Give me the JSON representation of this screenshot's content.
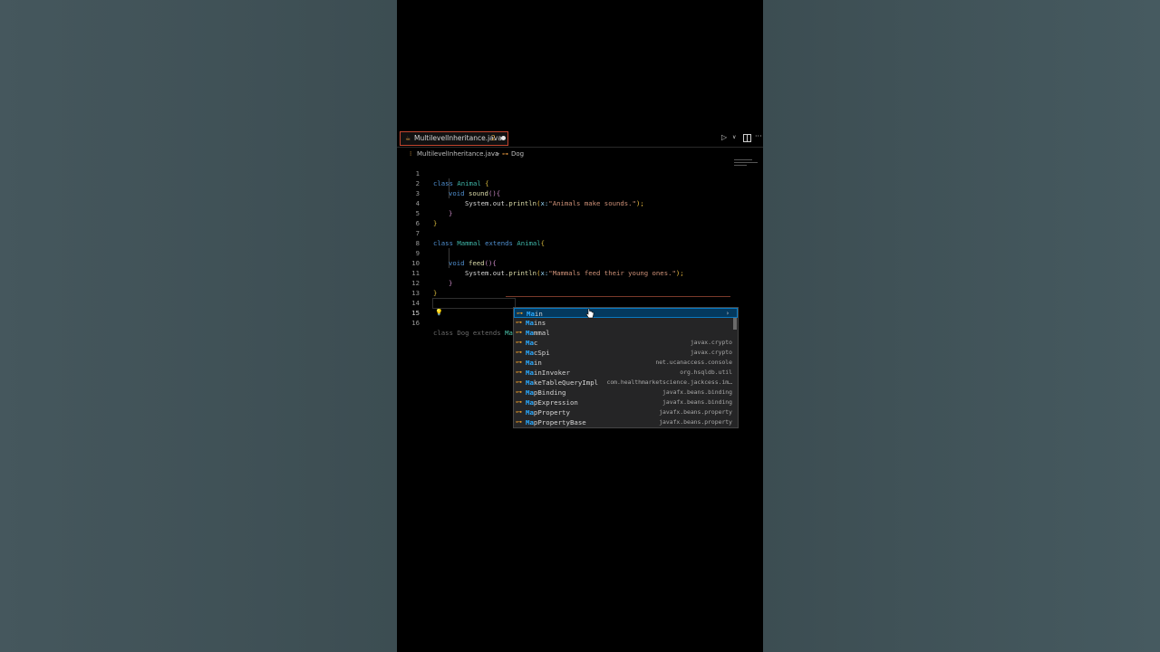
{
  "tab": {
    "filename": "MultilevelInheritance.java",
    "problem_count": "2"
  },
  "breadcrumb": {
    "file": "MultilevelInheritance.java",
    "separator": ">",
    "class_name": "Dog"
  },
  "code": {
    "line_numbers": [
      "1",
      "2",
      "3",
      "4",
      "5",
      "6",
      "7",
      "8",
      "9",
      "10",
      "11",
      "12",
      "13",
      "14",
      "15",
      "16"
    ],
    "l1_kw": "class",
    "l1_type": "Animal",
    "l1_brace": "{",
    "l2_kw": "void",
    "l2_fn": "sound",
    "l2_parens": "()",
    "l2_brace": "{",
    "l3_obj": "System.out.",
    "l3_fn": "println",
    "l3_open": "(",
    "l3_param": "x:",
    "l3_str": "\"Animals make sounds.\"",
    "l3_close": ");",
    "l4_brace": "}",
    "l5_brace": "}",
    "l7_kw": "class",
    "l7_type": "Mammal",
    "l7_ext": "extends",
    "l7_super": "Animal",
    "l7_brace": "{",
    "l9_kw": "void",
    "l9_fn": "feed",
    "l9_parens": "()",
    "l9_brace": "{",
    "l10_obj": "System.out.",
    "l10_fn": "println",
    "l10_open": "(",
    "l10_param": "x:",
    "l10_str": "\"Mammals feed their young ones.\"",
    "l10_close": ");",
    "l11_brace": "}",
    "l12_brace": "}",
    "l15_text": "class Dog extends ",
    "l15_typed": "Ma"
  },
  "suggestions": [
    {
      "match": "Ma",
      "rest": "in",
      "detail": "",
      "selected": true
    },
    {
      "match": "Ma",
      "rest": "ins",
      "detail": ""
    },
    {
      "match": "Ma",
      "rest": "mmal",
      "detail": ""
    },
    {
      "match": "Ma",
      "rest": "c",
      "detail": "javax.crypto"
    },
    {
      "match": "Ma",
      "rest": "cSpi",
      "detail": "javax.crypto"
    },
    {
      "match": "Ma",
      "rest": "in",
      "detail": "net.ucanaccess.console"
    },
    {
      "match": "Ma",
      "rest": "inInvoker",
      "detail": "org.hsqldb.util"
    },
    {
      "match": "Ma",
      "rest": "keTableQueryImpl",
      "detail": "com.healthmarketscience.jackcess.im…"
    },
    {
      "match": "Ma",
      "rest": "pBinding",
      "detail": "javafx.beans.binding"
    },
    {
      "match": "Ma",
      "rest": "pExpression",
      "detail": "javafx.beans.binding"
    },
    {
      "match": "Ma",
      "rest": "pProperty",
      "detail": "javafx.beans.property"
    },
    {
      "match": "Ma",
      "rest": "pPropertyBase",
      "detail": "javafx.beans.property"
    }
  ],
  "icons": {
    "class_icon": "class-icon",
    "chevron": "›"
  },
  "colors": {
    "accent_blue": "#2aaaff",
    "class_icon": "#ee9d28",
    "tab_border": "#c2462f"
  }
}
